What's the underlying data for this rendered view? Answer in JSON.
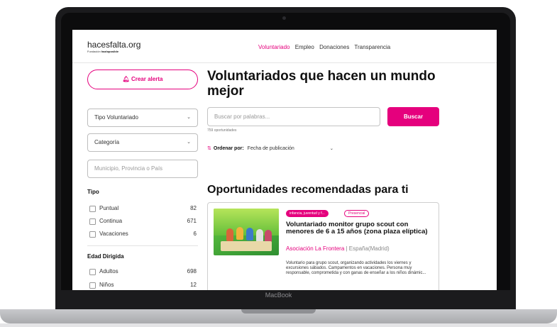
{
  "device": {
    "label": "MacBook"
  },
  "header": {
    "logo": "hacesfalta.org",
    "logo_sub_prefix": "Fundación",
    "logo_sub_brand": "hazloposible",
    "nav": [
      {
        "label": "Voluntariado",
        "active": true
      },
      {
        "label": "Empleo",
        "active": false
      },
      {
        "label": "Donaciones",
        "active": false
      },
      {
        "label": "Transparencia",
        "active": false
      }
    ]
  },
  "sidebar": {
    "alert_button": "Crear alerta",
    "volunteer_type_select": "Tipo Voluntariado",
    "category_select": "Categoría",
    "location_placeholder": "Municipio, Provincia o País",
    "tipo": {
      "title": "Tipo",
      "items": [
        {
          "label": "Puntual",
          "count": "82"
        },
        {
          "label": "Continua",
          "count": "671"
        },
        {
          "label": "Vacaciones",
          "count": "6"
        }
      ]
    },
    "edad": {
      "title": "Edad Dirigida",
      "items": [
        {
          "label": "Adultos",
          "count": "698"
        },
        {
          "label": "Niños",
          "count": "12"
        }
      ]
    }
  },
  "main": {
    "title": "Voluntariados que hacen un mundo mejor",
    "search_placeholder": "Buscar por palabras...",
    "search_button": "Buscar",
    "results_count": "759 oportunidades",
    "sort_label": "Ordenar por:",
    "sort_value": "Fecha de publicación",
    "recommended_title": "Oportunidades recomendadas para ti",
    "card": {
      "badge_category": "infancia, juventud y f...",
      "badge_mode": "Presencial",
      "title": "Voluntariado monitor grupo scout con menores de 6 a 15 años (zona plaza elíptica)",
      "organization": "Asociación La Frontera",
      "location": "| España(Madrid)",
      "description": "Voluntario para grupo scout, organizando actividades los viernes y excursiones sábados. Campamentos en vacaciones. Persona muy responsable, comprometida y con ganas de enseñar a los niños dinámic..."
    }
  },
  "colors": {
    "accent": "#e5007d"
  }
}
